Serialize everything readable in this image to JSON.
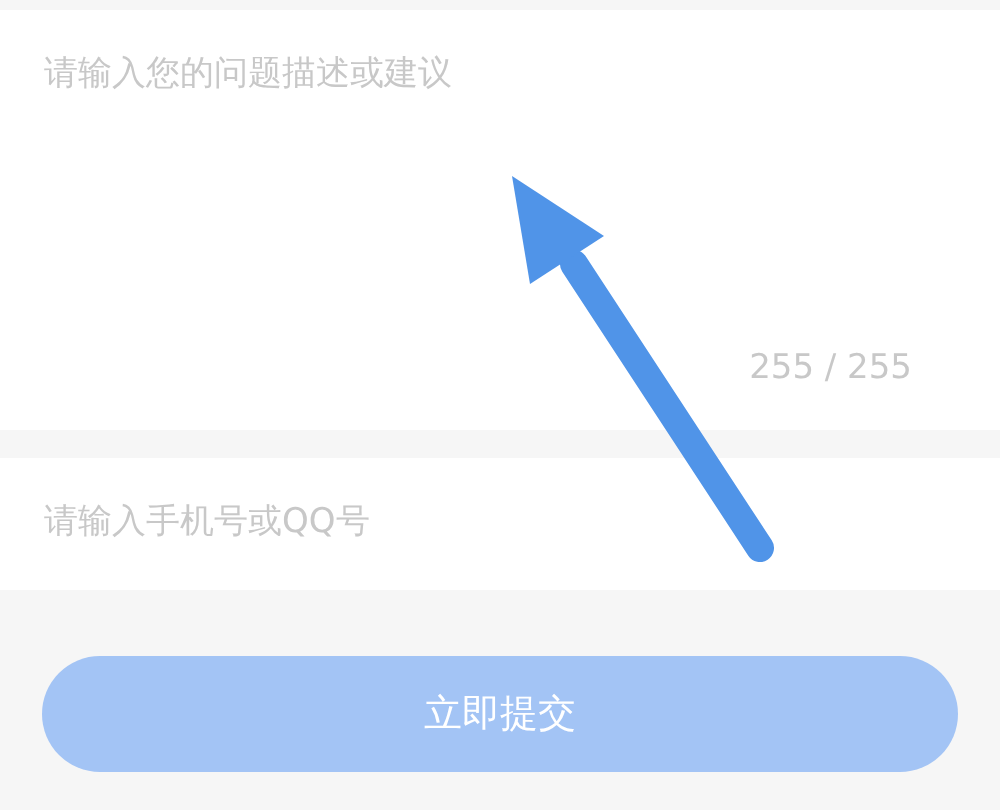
{
  "feedback": {
    "placeholder": "请输入您的问题描述或建议",
    "counter": "255 / 255"
  },
  "contact": {
    "placeholder": "请输入手机号或QQ号"
  },
  "submit": {
    "label": "立即提交",
    "disabled": true
  }
}
